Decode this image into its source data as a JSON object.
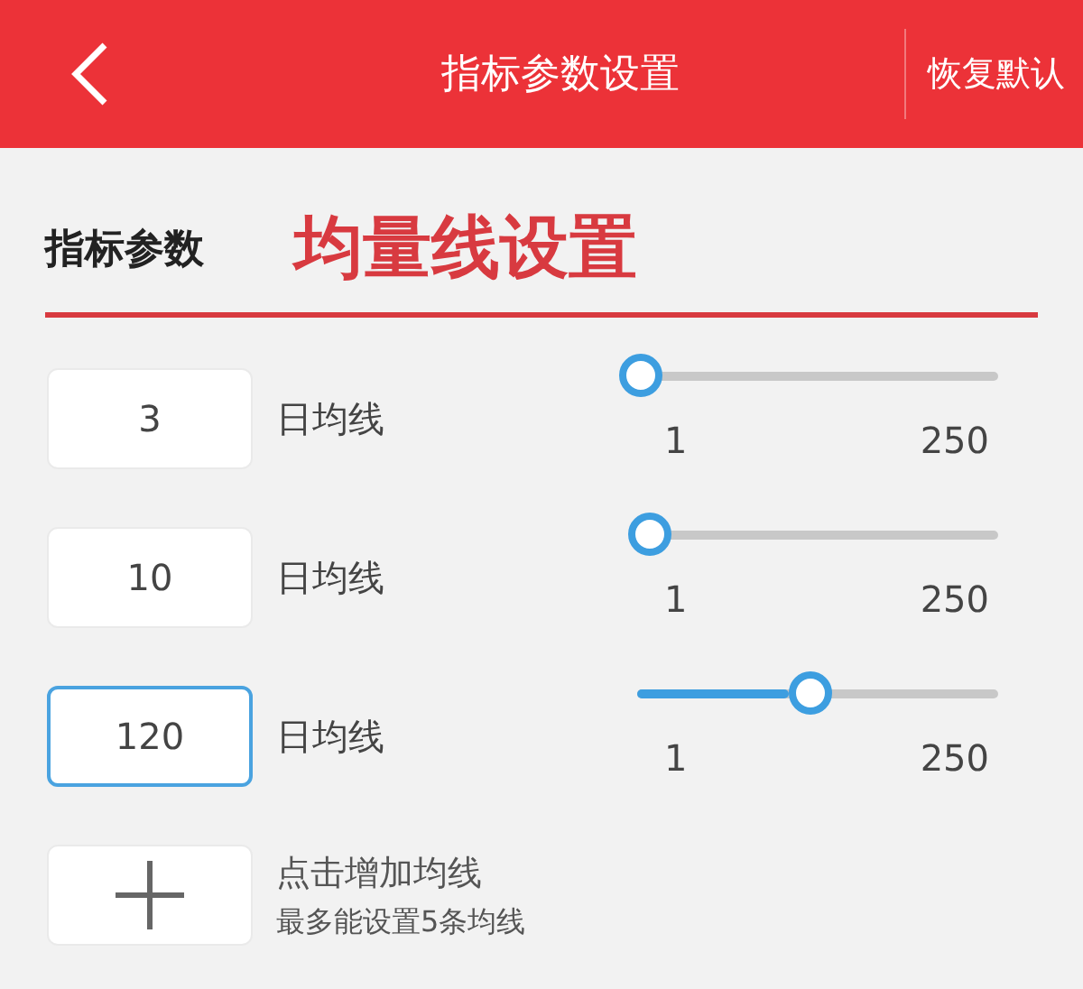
{
  "header": {
    "title": "指标参数设置",
    "action": "恢复默认"
  },
  "section": {
    "title": "指标参数",
    "annotation": "均量线设置"
  },
  "lines": [
    {
      "value": "3",
      "label": "日均线",
      "focused": false,
      "level": 0.008,
      "min": "1",
      "max": "250"
    },
    {
      "value": "10",
      "label": "日均线",
      "focused": false,
      "level": 0.036,
      "min": "1",
      "max": "250"
    },
    {
      "value": "120",
      "label": "日均线",
      "focused": true,
      "level": 0.48,
      "min": "1",
      "max": "250"
    }
  ],
  "add": {
    "title": "点击增加均线",
    "hint": "最多能设置5条均线"
  }
}
